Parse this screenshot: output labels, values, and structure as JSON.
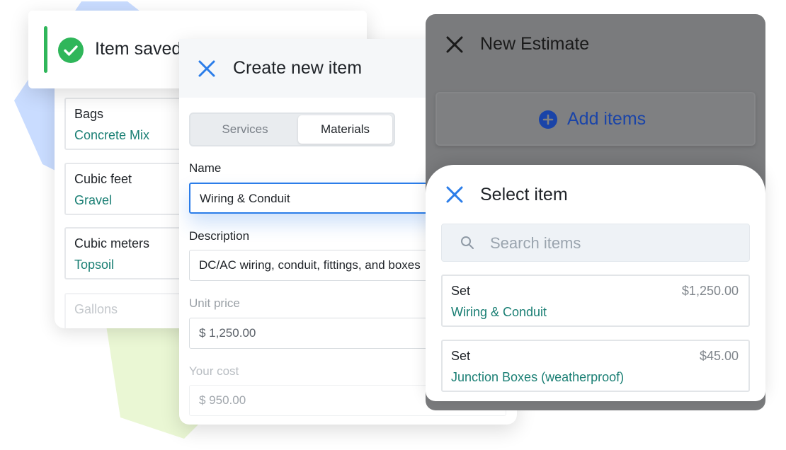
{
  "colors": {
    "accent_blue": "#2b7de9",
    "success_green": "#2fb65a",
    "item_teal": "#1a7f74"
  },
  "icons": {
    "toast": "check-circle-icon",
    "close": "close-icon",
    "add": "plus-circle-icon",
    "search": "search-icon"
  },
  "materials_list": {
    "items": [
      {
        "unit": "Bags",
        "name": "Concrete Mix"
      },
      {
        "unit": "Cubic feet",
        "name": "Gravel"
      },
      {
        "unit": "Cubic meters",
        "name": "Topsoil"
      },
      {
        "unit": "Gallons",
        "name": ""
      }
    ]
  },
  "toast": {
    "message": "Item saved"
  },
  "create_item": {
    "title": "Create new item",
    "tabs": [
      {
        "label": "Services",
        "selected": false
      },
      {
        "label": "Materials",
        "selected": true
      }
    ],
    "name_label": "Name",
    "name_value": "Wiring & Conduit",
    "description_label": "Description",
    "description_value": "DC/AC wiring, conduit, fittings, and boxes",
    "unit_price_label": "Unit price",
    "unit_price_value": "$ 1,250.00",
    "your_cost_label": "Your cost",
    "your_cost_value": "$ 950.00"
  },
  "estimate": {
    "title": "New Estimate",
    "add_items_label": "Add items"
  },
  "select_item": {
    "title": "Select item",
    "search_placeholder": "Search items",
    "results": [
      {
        "unit": "Set",
        "price": "$1,250.00",
        "name": "Wiring & Conduit"
      },
      {
        "unit": "Set",
        "price": "$45.00",
        "name": "Junction Boxes (weatherproof)"
      }
    ]
  }
}
